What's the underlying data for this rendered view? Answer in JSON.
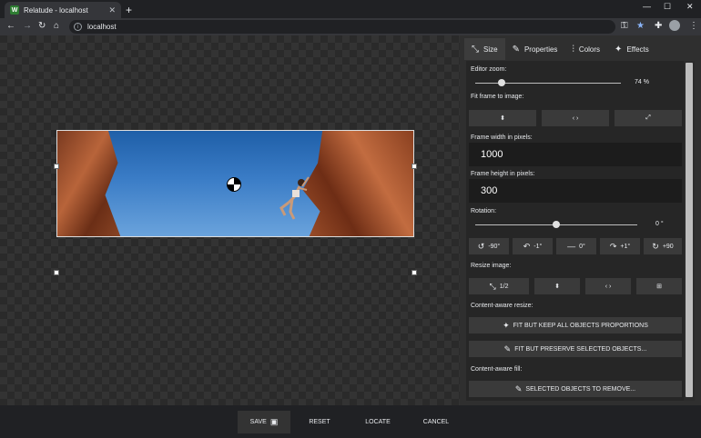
{
  "browser": {
    "tab_title": "Relatude - localhost",
    "favicon_letter": "W",
    "url": "localhost"
  },
  "panel": {
    "tabs": [
      {
        "label": "Size",
        "icon": "resize-icon"
      },
      {
        "label": "Properties",
        "icon": "pencil-icon"
      },
      {
        "label": "Colors",
        "icon": "sliders-icon"
      },
      {
        "label": "Effects",
        "icon": "magic-wand-icon"
      }
    ],
    "editor_zoom_label": "Editor zoom:",
    "editor_zoom_value": "74 %",
    "editor_zoom_fraction": 0.18,
    "fit_frame_label": "Fit frame to image:",
    "frame_width_label": "Frame width in pixels:",
    "frame_width_value": "1000",
    "frame_height_label": "Frame height in pixels:",
    "frame_height_value": "300",
    "rotation_label": "Rotation:",
    "rotation_value": "0 °",
    "rotation_fraction": 0.5,
    "rotate_buttons": [
      "-90°",
      "-1°",
      "0°",
      "+1°",
      "+90"
    ],
    "resize_label": "Resize image:",
    "resize_half": "1/2",
    "content_aware_resize_label": "Content-aware resize:",
    "fit_keep_label": "FIT BUT KEEP ALL OBJECTS PROPORTIONS",
    "fit_preserve_label": "FIT BUT PRESERVE SELECTED OBJECTS...",
    "content_aware_fill_label": "Content-aware fill:",
    "remove_label": "SELECTED OBJECTS TO REMOVE..."
  },
  "bottom": {
    "save": "SAVE",
    "reset": "RESET",
    "locate": "LOCATE",
    "cancel": "CANCEL"
  }
}
